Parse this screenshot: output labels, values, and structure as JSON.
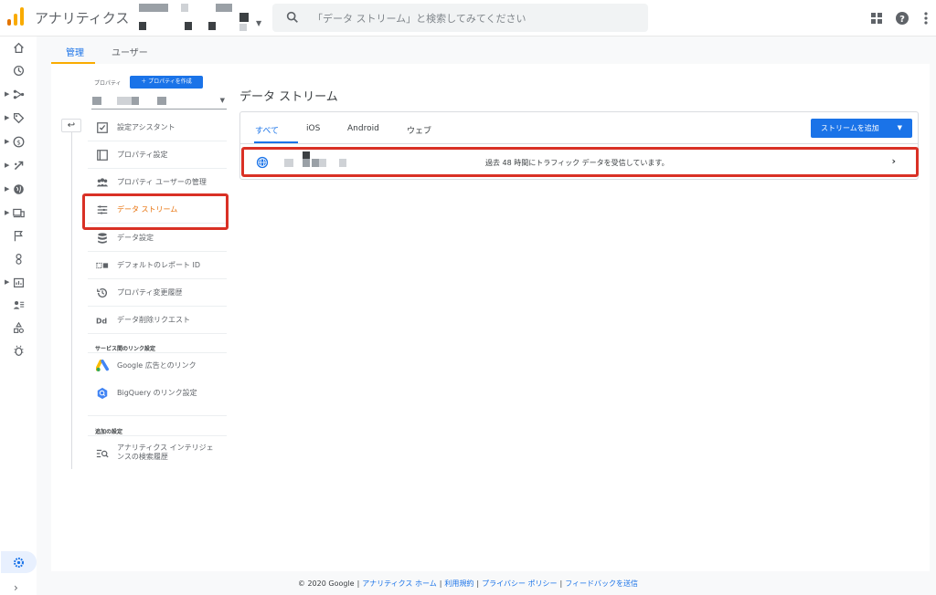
{
  "header": {
    "app_title": "アナリティクス",
    "search_placeholder": "「データ ストリーム」と検索してみてください"
  },
  "admin_tabs": [
    {
      "label": "管理",
      "active": true
    },
    {
      "label": "ユーザー",
      "active": false
    }
  ],
  "property": {
    "label": "プロパティ",
    "create_button": "＋ プロパティを作成"
  },
  "nav": {
    "items": [
      {
        "label": "設定アシスタント",
        "icon": "checklist-icon"
      },
      {
        "label": "プロパティ設定",
        "icon": "property-settings-icon"
      },
      {
        "label": "プロパティ ユーザーの管理",
        "icon": "users-icon"
      },
      {
        "label": "データ ストリーム",
        "icon": "data-stream-icon",
        "active": true
      },
      {
        "label": "データ設定",
        "icon": "database-icon"
      },
      {
        "label": "デフォルトのレポート ID",
        "icon": "report-id-icon"
      },
      {
        "label": "プロパティ変更履歴",
        "icon": "history-icon"
      },
      {
        "label": "データ削除リクエスト",
        "icon": "data-deletion-icon"
      }
    ],
    "section_links": "サービス間のリンク設定",
    "links": [
      {
        "label": "Google 広告とのリンク",
        "icon": "google-ads-icon"
      },
      {
        "label": "BigQuery のリンク設定",
        "icon": "bigquery-icon"
      }
    ],
    "section_additional": "追加の設定",
    "additional": [
      {
        "label": "アナリティクス インテリジェンスの検索履歴",
        "icon": "search-history-icon"
      }
    ]
  },
  "main": {
    "title": "データ ストリーム",
    "tabs": [
      {
        "label": "すべて",
        "active": true
      },
      {
        "label": "iOS",
        "active": false
      },
      {
        "label": "Android",
        "active": false
      },
      {
        "label": "ウェブ",
        "active": false
      }
    ],
    "add_stream_button": "ストリームを追加",
    "stream": {
      "icon": "globe-icon",
      "status": "過去 48 時間にトラフィック データを受信しています。"
    }
  },
  "footer": {
    "copyright": "© 2020 Google",
    "links": [
      "アナリティクス ホーム",
      "利用規約",
      "プライバシー ポリシー",
      "フィードバックを送信"
    ]
  },
  "colors": {
    "accent": "#1a73e8",
    "highlight": "#d93025",
    "tab_underline": "#f9ab00",
    "active_nav": "#e8710a"
  }
}
